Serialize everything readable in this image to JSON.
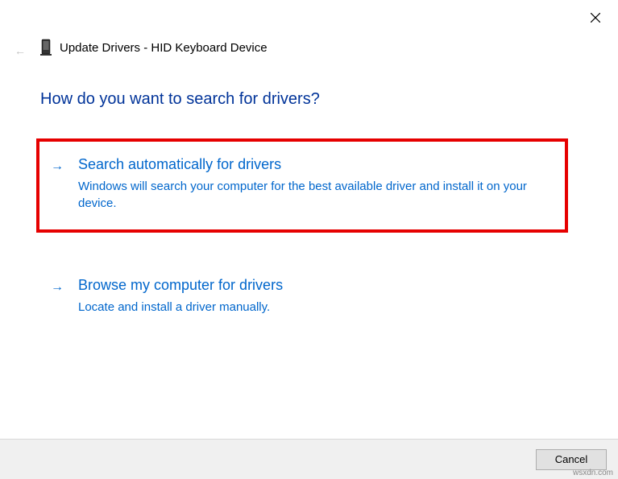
{
  "header": {
    "title": "Update Drivers - HID Keyboard Device"
  },
  "question": "How do you want to search for drivers?",
  "options": [
    {
      "title": "Search automatically for drivers",
      "description": "Windows will search your computer for the best available driver and install it on your device."
    },
    {
      "title": "Browse my computer for drivers",
      "description": "Locate and install a driver manually."
    }
  ],
  "footer": {
    "cancel_label": "Cancel"
  },
  "watermark": "wsxdn.com"
}
